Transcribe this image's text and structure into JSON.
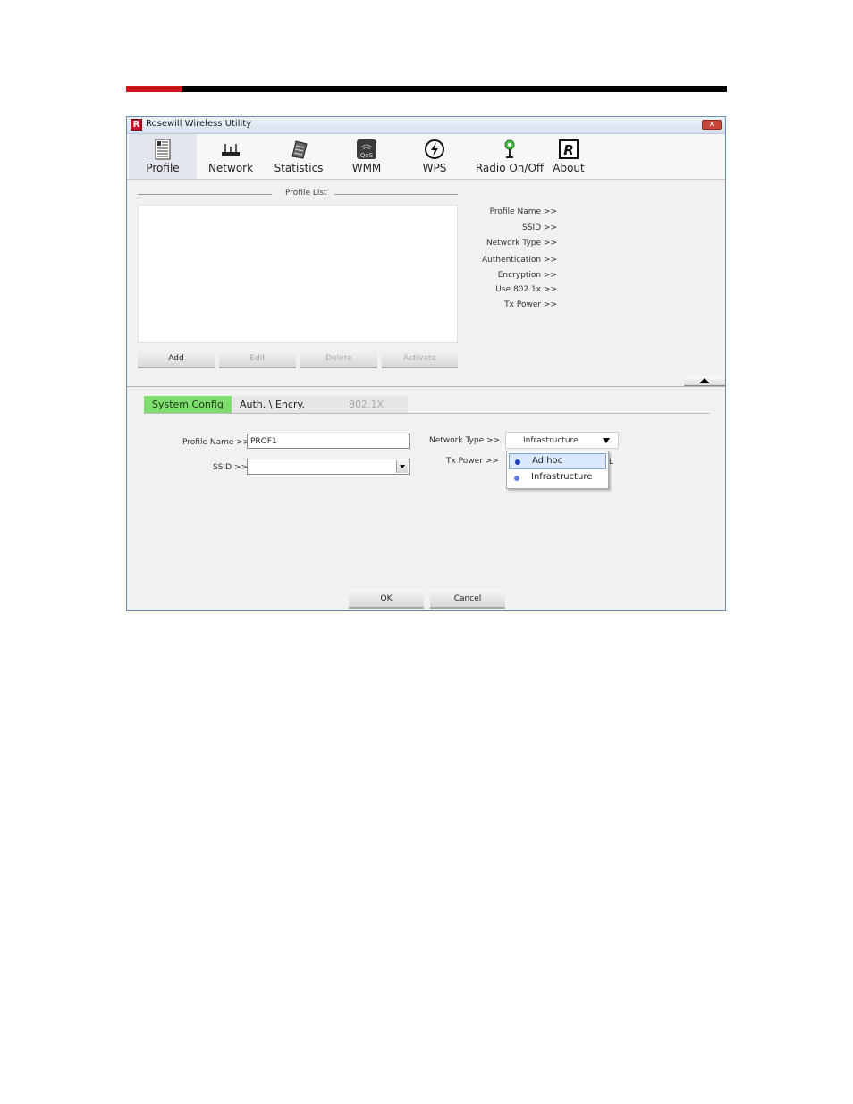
{
  "window": {
    "title": "Rosewill Wireless Utility",
    "app_icon_letter": "R",
    "close_label": "x"
  },
  "toolbar": {
    "items": [
      {
        "label": "Profile",
        "icon": "profile-icon",
        "active": true
      },
      {
        "label": "Network",
        "icon": "router-icon"
      },
      {
        "label": "Statistics",
        "icon": "statistics-icon"
      },
      {
        "label": "WMM",
        "icon": "qos-icon"
      },
      {
        "label": "WPS",
        "icon": "wps-icon"
      },
      {
        "label": "Radio On/Off",
        "icon": "antenna-icon"
      },
      {
        "label": "About",
        "icon": "rosewill-logo-icon"
      }
    ]
  },
  "profile_list": {
    "title": "Profile List",
    "buttons": {
      "add": "Add",
      "edit": "Edit",
      "delete": "Delete",
      "activate": "Activate"
    }
  },
  "profile_info": {
    "profile_name": "Profile Name >>",
    "ssid": "SSID >>",
    "network_type": "Network Type >>",
    "authentication": "Authentication >>",
    "encryption": "Encryption >>",
    "use_8021x": "Use 802.1x >>",
    "tx_power": "Tx Power >>"
  },
  "tabs": {
    "system_config": "System Config",
    "auth_encry": "Auth. \\ Encry.",
    "dot1x": "802.1X"
  },
  "form": {
    "profile_name_label": "Profile Name >>",
    "profile_name_value": "PROF1",
    "ssid_label": "SSID >>",
    "ssid_value": "",
    "network_type_label": "Network Type >>",
    "network_type_value": "Infrastructure",
    "tx_power_label": "Tx Power >>",
    "network_type_options": [
      "Ad hoc",
      "Infrastructure"
    ],
    "hidden_side_glyph": "L"
  },
  "footer": {
    "ok": "OK",
    "cancel": "Cancel"
  },
  "colors": {
    "active_tab": "#7fdc6e",
    "brand_red": "#d0141e",
    "window_border": "#6a8db3"
  }
}
